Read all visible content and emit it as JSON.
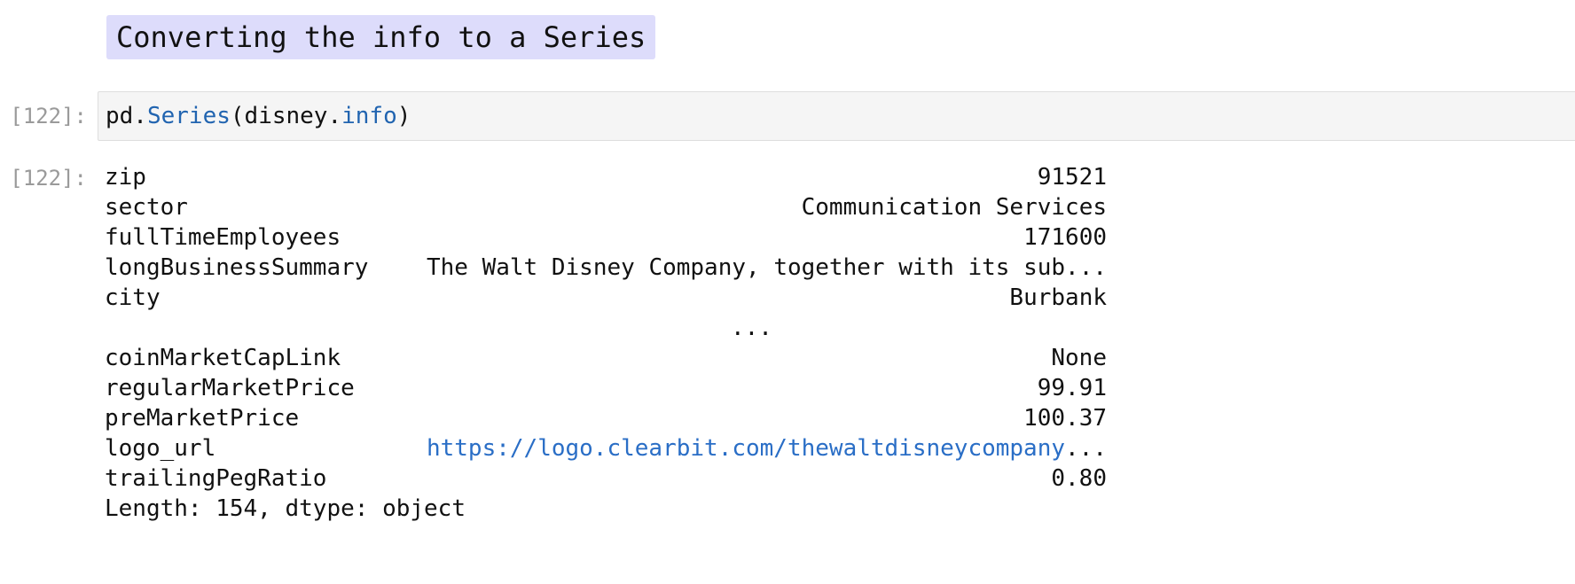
{
  "markdown_cell": {
    "heading": "Converting the info to a Series"
  },
  "code_cell": {
    "prompt_in": "[122]:",
    "code_parts": [
      "pd.",
      "Series",
      "(disney.",
      "info",
      ")"
    ]
  },
  "output_cell": {
    "prompt_out": "[122]:",
    "rows_top": [
      {
        "key": "zip",
        "value": "91521"
      },
      {
        "key": "sector",
        "value": "Communication Services"
      },
      {
        "key": "fullTimeEmployees",
        "value": "171600"
      },
      {
        "key": "longBusinessSummary",
        "value": "The Walt Disney Company, together with its sub..."
      },
      {
        "key": "city",
        "value": "Burbank"
      }
    ],
    "ellipsis": "...",
    "rows_bottom": [
      {
        "key": "coinMarketCapLink",
        "value": "None"
      },
      {
        "key": "regularMarketPrice",
        "value": "99.91"
      },
      {
        "key": "preMarketPrice",
        "value": "100.37"
      },
      {
        "key": "logo_url",
        "value_link": "https://logo.clearbit.com/thewaltdisneycompany",
        "value_suffix": "..."
      },
      {
        "key": "trailingPegRatio",
        "value": "0.80"
      }
    ],
    "footer": "Length: 154, dtype: object"
  }
}
